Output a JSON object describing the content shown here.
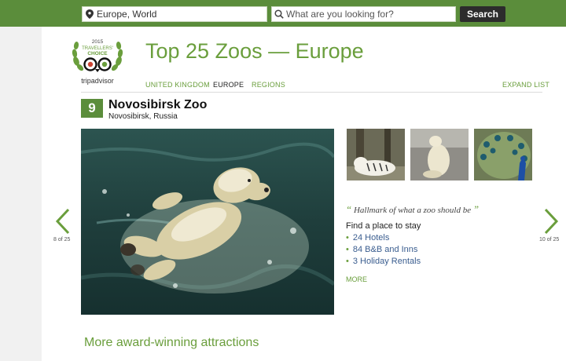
{
  "search": {
    "location_value": "Europe, World",
    "query_placeholder": "What are you looking for?",
    "button_label": "Search"
  },
  "logo": {
    "year": "2015",
    "line1": "TRAVELLERS'",
    "line2": "CHOICE",
    "brand": "tripadvisor"
  },
  "page": {
    "title": "Top 25 Zoos — Europe"
  },
  "nav": {
    "items": [
      "UNITED KINGDOM",
      "EUROPE",
      "REGIONS"
    ],
    "active": "EUROPE",
    "expand_label": "EXPAND LIST"
  },
  "entry": {
    "rank": "9",
    "name": "Novosibirsk Zoo",
    "location": "Novosibirsk, Russia",
    "quote": "Hallmark of what a zoo should be",
    "find_heading": "Find a place to stay",
    "options": [
      "24 Hotels",
      "84 B&B and Inns",
      "3 Holiday Rentals"
    ],
    "more_label": "MORE"
  },
  "pager": {
    "prev": "8 of 25",
    "next": "10 of 25"
  },
  "footer": {
    "heading": "More award-winning attractions"
  },
  "colors": {
    "brand_green": "#5b8d3b",
    "title_green": "#6a9e3c",
    "link_blue": "#3a5d8f"
  },
  "icons": {
    "location": "map-pin-icon",
    "search": "magnifier-icon",
    "prev": "chevron-left-icon",
    "next": "chevron-right-icon"
  }
}
